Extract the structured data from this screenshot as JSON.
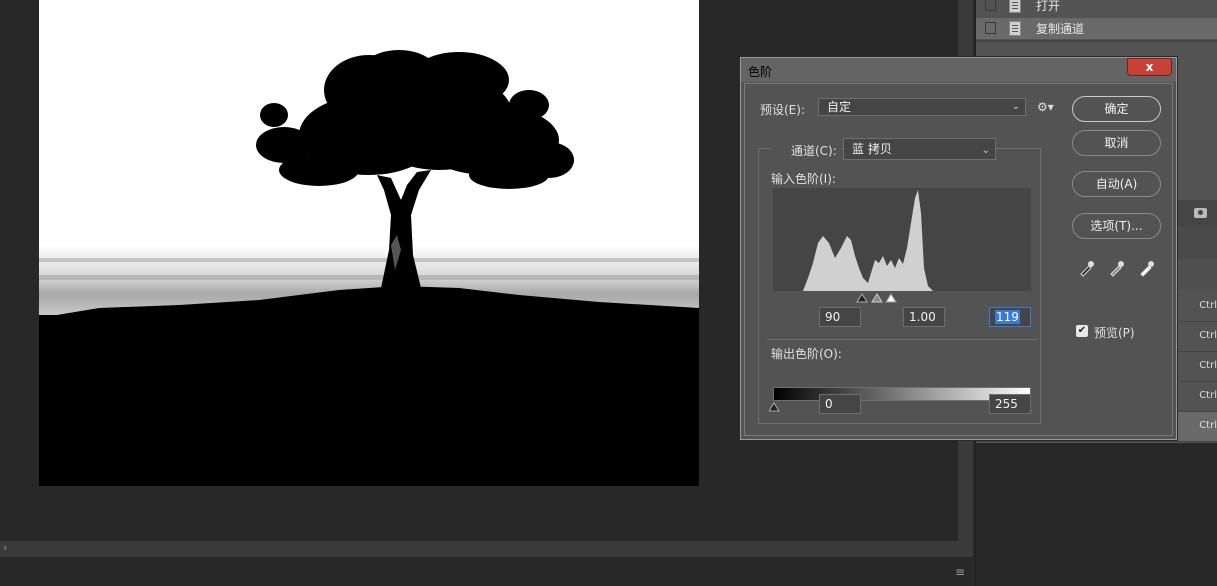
{
  "history": {
    "items": [
      {
        "label": "打开"
      },
      {
        "label": "复制通道"
      }
    ]
  },
  "shortcuts": [
    "Ctrl",
    "Ctrl",
    "Ctrl",
    "Ctrl",
    "Ctrl"
  ],
  "dialog": {
    "title": "色阶",
    "close_label": "x",
    "preset_label": "预设(E):",
    "preset_value": "自定",
    "channel_label": "通道(C):",
    "channel_value": "蓝 拷贝",
    "input_levels_label": "输入色阶(I):",
    "input_black": "90",
    "input_gamma": "1.00",
    "input_white": "119",
    "output_levels_label": "输出色阶(O):",
    "output_black": "0",
    "output_white": "255",
    "buttons": {
      "ok": "确定",
      "cancel": "取消",
      "auto": "自动(A)",
      "options": "选项(T)..."
    },
    "preview_label": "预览(P)",
    "preview_checked": true
  }
}
